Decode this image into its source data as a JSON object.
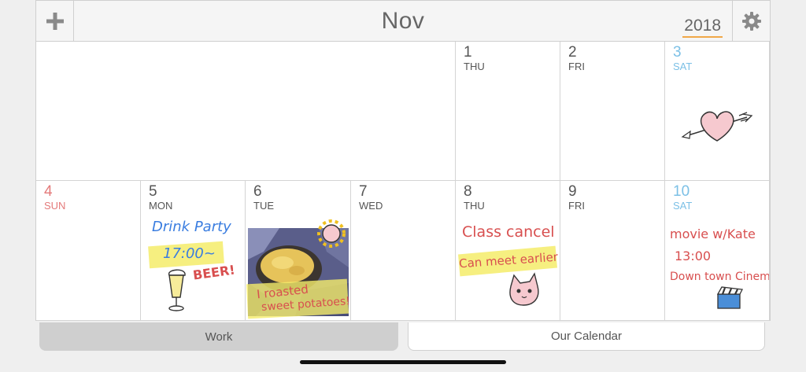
{
  "header": {
    "month": "Nov",
    "year": "2018",
    "add_icon": "plus-icon",
    "settings_icon": "gear-icon"
  },
  "days": [
    {
      "num": "1",
      "name": "THU"
    },
    {
      "num": "2",
      "name": "FRI"
    },
    {
      "num": "3",
      "name": "SAT"
    },
    {
      "num": "4",
      "name": "SUN"
    },
    {
      "num": "5",
      "name": "MON"
    },
    {
      "num": "6",
      "name": "TUE"
    },
    {
      "num": "7",
      "name": "WED"
    },
    {
      "num": "8",
      "name": "THU"
    },
    {
      "num": "9",
      "name": "FRI"
    },
    {
      "num": "10",
      "name": "SAT"
    }
  ],
  "notes": {
    "d5": {
      "line1": "Drink Party",
      "line2": "17:00~",
      "beer": "BEER!"
    },
    "d6": {
      "line1": "I roasted",
      "line2": "sweet potatoes!"
    },
    "d8": {
      "line1": "Class cancel",
      "line2": "Can meet earlier"
    },
    "d10": {
      "line1": "movie w/Kate",
      "line2": "13:00",
      "line3": "Down town Cinema"
    }
  },
  "tabs": {
    "work": "Work",
    "our_calendar": "Our Calendar"
  },
  "colors": {
    "saturday": "#7cc0e6",
    "sunday": "#e47a7a",
    "year_underline": "#f0a848",
    "highlight": "#f5ec6a"
  }
}
